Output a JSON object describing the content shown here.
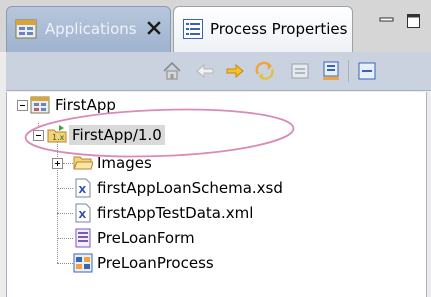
{
  "tabs": [
    {
      "label": "Applications",
      "active": false
    },
    {
      "label": "Process Properties",
      "active": true
    }
  ],
  "toolbar": {
    "buttons": [
      "home-icon",
      "back-arrow-icon",
      "forward-arrow-icon",
      "sync-icon",
      "collapse-icon",
      "filter-icon",
      "view-menu-icon"
    ]
  },
  "tree": {
    "root": {
      "label": "FirstApp",
      "expanded": true
    },
    "version": {
      "label": "FirstApp/1.0",
      "expanded": true,
      "selected": true
    },
    "children": [
      {
        "label": "Images",
        "type": "folder",
        "expandable": true
      },
      {
        "label": "firstAppLoanSchema.xsd",
        "type": "xsd"
      },
      {
        "label": "firstAppTestData.xml",
        "type": "xml"
      },
      {
        "label": "PreLoanForm",
        "type": "form"
      },
      {
        "label": "PreLoanProcess",
        "type": "process"
      }
    ]
  },
  "colors": {
    "callout": "#d98bb8",
    "selection": "#d9d9d9",
    "tab_active_bg": "#ffffff",
    "tab_inactive_bg": "#a9bbd4"
  }
}
